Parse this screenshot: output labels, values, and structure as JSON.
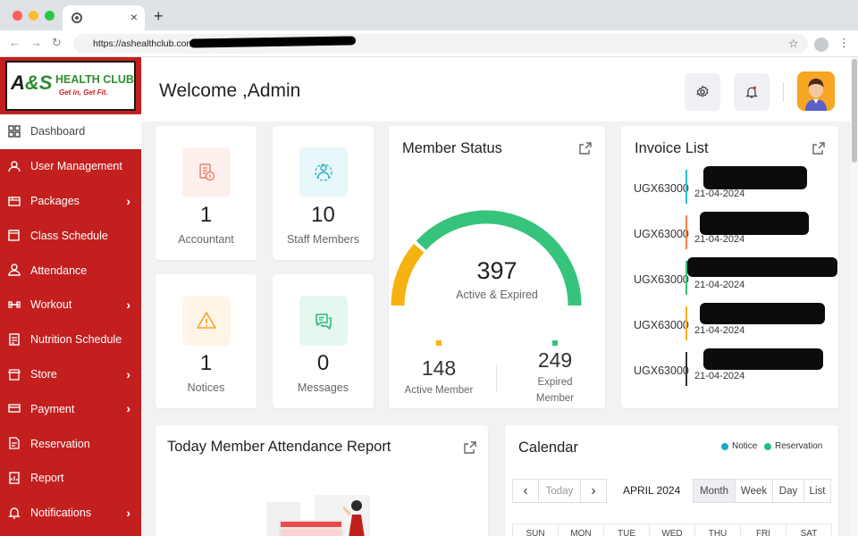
{
  "browser": {
    "url": "https://ashealthclub.com/",
    "new_tab": "+",
    "tab_close": "×"
  },
  "logo": {
    "mark_a": "A",
    "mark_s": "&S",
    "name": "HEALTH CLUB",
    "tagline": "Get in, Get Fit."
  },
  "sidebar": {
    "items": [
      {
        "label": "Dashboard",
        "icon": "dashboard-grid-icon",
        "active": true,
        "chevron": false
      },
      {
        "label": "User Management",
        "icon": "user-gear-icon",
        "active": false,
        "chevron": false
      },
      {
        "label": "Packages",
        "icon": "package-icon",
        "active": false,
        "chevron": true
      },
      {
        "label": "Class Schedule",
        "icon": "calendar-icon",
        "active": false,
        "chevron": false
      },
      {
        "label": "Attendance",
        "icon": "person-icon",
        "active": false,
        "chevron": false
      },
      {
        "label": "Workout",
        "icon": "dumbbell-icon",
        "active": false,
        "chevron": true
      },
      {
        "label": "Nutrition Schedule",
        "icon": "nutrition-icon",
        "active": false,
        "chevron": false
      },
      {
        "label": "Store",
        "icon": "store-icon",
        "active": false,
        "chevron": true
      },
      {
        "label": "Payment",
        "icon": "payment-icon",
        "active": false,
        "chevron": true
      },
      {
        "label": "Reservation",
        "icon": "reservation-icon",
        "active": false,
        "chevron": false
      },
      {
        "label": "Report",
        "icon": "report-icon",
        "active": false,
        "chevron": false
      },
      {
        "label": "Notifications",
        "icon": "bell-icon",
        "active": false,
        "chevron": true
      }
    ],
    "chevron_glyph": "›"
  },
  "header": {
    "welcome": "Welcome ,Admin"
  },
  "stats": [
    {
      "value": "1",
      "label": "Accountant",
      "icon": "accountant-icon",
      "color": "#e8836a",
      "bg": "#fdf0ec"
    },
    {
      "value": "10",
      "label": "Staff Members",
      "icon": "staff-icon",
      "color": "#2ab1c4",
      "bg": "#e8f7f9"
    },
    {
      "value": "1",
      "label": "Notices",
      "icon": "warning-icon",
      "color": "#f3a530",
      "bg": "#fef5e8"
    },
    {
      "value": "0",
      "label": "Messages",
      "icon": "chat-icon",
      "color": "#28b87d",
      "bg": "#e6f7ef"
    }
  ],
  "member_status": {
    "title": "Member Status",
    "total": "397",
    "total_label": "Active & Expired",
    "active_value": 148,
    "active_label": "Active Member",
    "expired_value": 249,
    "expired_label_1": "Expired",
    "expired_label_2": "Member",
    "active_color": "#f5b210",
    "expired_color": "#36c47c"
  },
  "invoice_list": {
    "title": "Invoice List",
    "rows": [
      {
        "code": "UGX63000",
        "date": "21-04-2024",
        "color": "#2cbfc7"
      },
      {
        "code": "UGX63000",
        "date": "21-04-2024",
        "color": "#f0824b"
      },
      {
        "code": "UGX63000",
        "date": "21-04-2024",
        "color": "#33c27a"
      },
      {
        "code": "UGX63000",
        "date": "21-04-2024",
        "color": "#f5b210"
      },
      {
        "code": "UGX63000",
        "date": "21-04-2024",
        "color": "#333333"
      }
    ]
  },
  "attendance": {
    "title": "Today Member Attendance Report"
  },
  "calendar": {
    "title": "Calendar",
    "legend_notice": "Notice",
    "legend_reservation": "Reservation",
    "notice_color": "#1ba9c7",
    "reservation_color": "#1fbf8f",
    "today": "Today",
    "month": "APRIL 2024",
    "views": [
      "Month",
      "Week",
      "Day",
      "List"
    ],
    "days": [
      "SUN",
      "MON",
      "TUE",
      "WED",
      "THU",
      "FRI",
      "SAT"
    ],
    "prev": "‹",
    "next": "›"
  }
}
